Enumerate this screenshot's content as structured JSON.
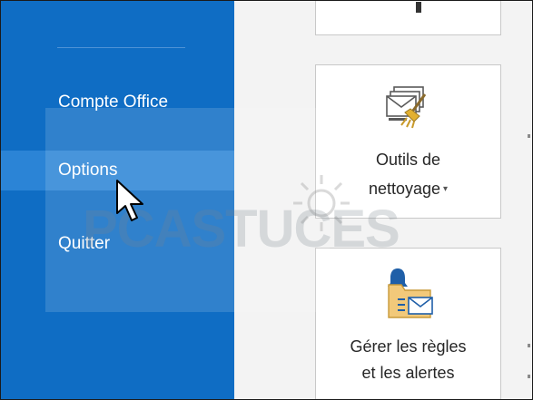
{
  "sidebar": {
    "items": [
      {
        "label": "Compte Office"
      },
      {
        "label": "Options"
      },
      {
        "label": "Quitter"
      }
    ],
    "hovered_item": "Options"
  },
  "tiles": [
    {
      "line1": "Outils de",
      "line2": "nettoyage",
      "has_dropdown": true,
      "icon": "cleanup-tools-icon"
    },
    {
      "line1": "Gérer les règles",
      "line2": "et les alertes",
      "has_dropdown": false,
      "icon": "rules-alerts-icon"
    }
  ],
  "watermark": {
    "text": "PCASTUCES"
  },
  "colors": {
    "sidebar_bg": "#0f6dc4",
    "sidebar_hover": "#2b84d6",
    "content_bg": "#f3f3f3",
    "tile_border": "#c8c8c8"
  }
}
